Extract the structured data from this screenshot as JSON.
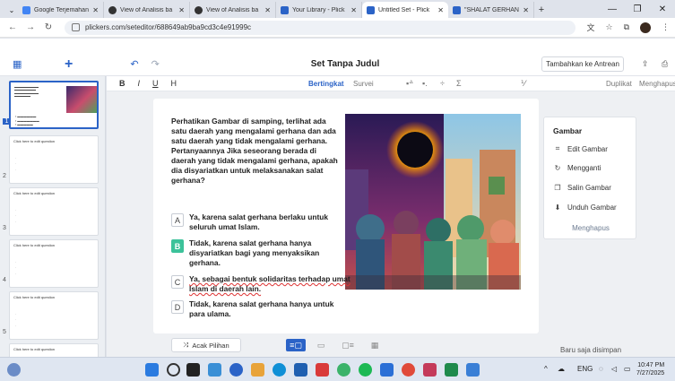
{
  "browser": {
    "tabs": [
      {
        "title": "Google Terjemahan",
        "color": "#4285f4"
      },
      {
        "title": "View of Analisis ba",
        "color": "#333333"
      },
      {
        "title": "View of Analisis ba",
        "color": "#333333"
      },
      {
        "title": "Your Library - Plick",
        "color": "#2b63c7"
      },
      {
        "title": "Untitled Set - Plick",
        "color": "#2b63c7",
        "active": true
      },
      {
        "title": "\"SHALAT GERHAN",
        "color": "#2b63c7"
      }
    ],
    "url": "plickers.com/seteditor/688649ab9ba9cd3c4e91999c"
  },
  "app": {
    "set_title": "Set Tanpa Judul",
    "add_to_queue": "Tambahkan ke Antrean",
    "format": {
      "bold": "B",
      "italic": "I",
      "underline": "U",
      "heading": "H"
    },
    "mode_graded": "Bertingkat",
    "mode_survey": "Survei",
    "duplicate": "Duplikat",
    "delete": "Menghapus",
    "shuffle": "Acak Pilihan",
    "saved_status": "Baru saja disimpan"
  },
  "sidebar": {
    "slides": [
      {
        "num": "1",
        "text": "",
        "active": true
      },
      {
        "num": "2",
        "text": "Click here to edit question"
      },
      {
        "num": "3",
        "text": "Click here to edit question"
      },
      {
        "num": "4",
        "text": "Click here to edit question"
      },
      {
        "num": "5",
        "text": "Click here to edit question"
      },
      {
        "num": "",
        "text": "Click here to edit question"
      }
    ]
  },
  "question": {
    "text": "Perhatikan Gambar di samping, terlihat ada satu daerah yang mengalami gerhana dan ada satu daerah yang tidak mengalami gerhana. Pertanyaannya Jika seseorang berada di daerah yang tidak mengalami gerhana, apakah dia disyariatkan untuk melaksanakan salat gerhana?",
    "choices": [
      {
        "letter": "A",
        "text": "Ya, karena salat gerhana berlaku untuk seluruh umat Islam.",
        "correct": false
      },
      {
        "letter": "B",
        "text": "Tidak, karena salat gerhana hanya disyariatkan bagi yang menyaksikan gerhana.",
        "correct": true
      },
      {
        "letter": "C",
        "text": "Ya, sebagai bentuk solidaritas terhadap umat Islam di daerah lain.",
        "correct": false
      },
      {
        "letter": "D",
        "text": "Tidak, karena salat gerhana hanya untuk para ulama.",
        "correct": false
      }
    ]
  },
  "image_panel": {
    "title": "Gambar",
    "items": [
      {
        "label": "Edit Gambar",
        "icon": "crop-icon"
      },
      {
        "label": "Mengganti",
        "icon": "refresh-icon"
      },
      {
        "label": "Salin Gambar",
        "icon": "copy-icon"
      },
      {
        "label": "Unduh Gambar",
        "icon": "download-icon"
      }
    ],
    "remove": "Menghapus"
  },
  "taskbar": {
    "lang": "ENG",
    "time": "10:47 PM",
    "date": "7/27/2025"
  },
  "colors": {
    "accent": "#2b63c7",
    "correct": "#3cc29a"
  }
}
